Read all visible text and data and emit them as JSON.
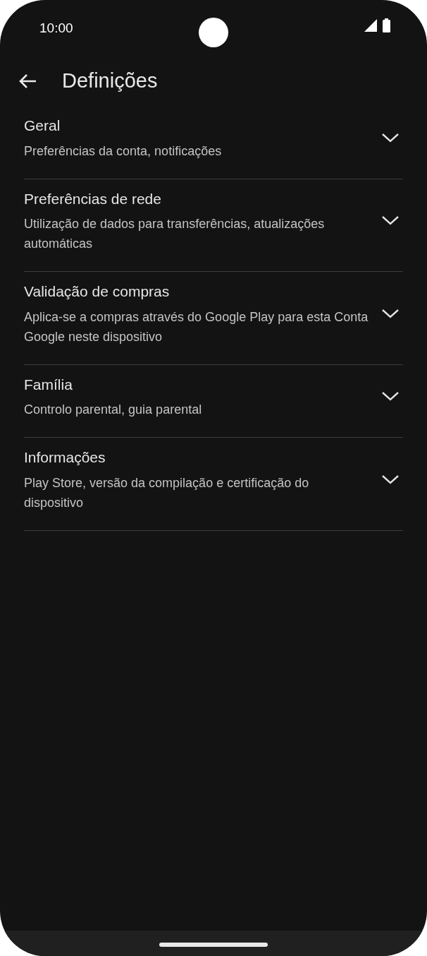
{
  "status_bar": {
    "time": "10:00"
  },
  "header": {
    "title": "Definições"
  },
  "sections": [
    {
      "title": "Geral",
      "subtitle": "Preferências da conta, notificações",
      "expanded": false
    },
    {
      "title": "Preferências de rede",
      "subtitle": "Utilização de dados para transferências, atualizações automáticas",
      "expanded": false
    },
    {
      "title": "Validação de compras",
      "subtitle": "Aplica-se a compras através do Google Play para esta Conta Google neste dispositivo",
      "expanded": false
    },
    {
      "title": "Família",
      "subtitle": "Controlo parental, guia parental",
      "expanded": false
    },
    {
      "title": "Informações",
      "subtitle": "Play Store, versão da compilação e certificação do dispositivo",
      "expanded": false
    }
  ]
}
